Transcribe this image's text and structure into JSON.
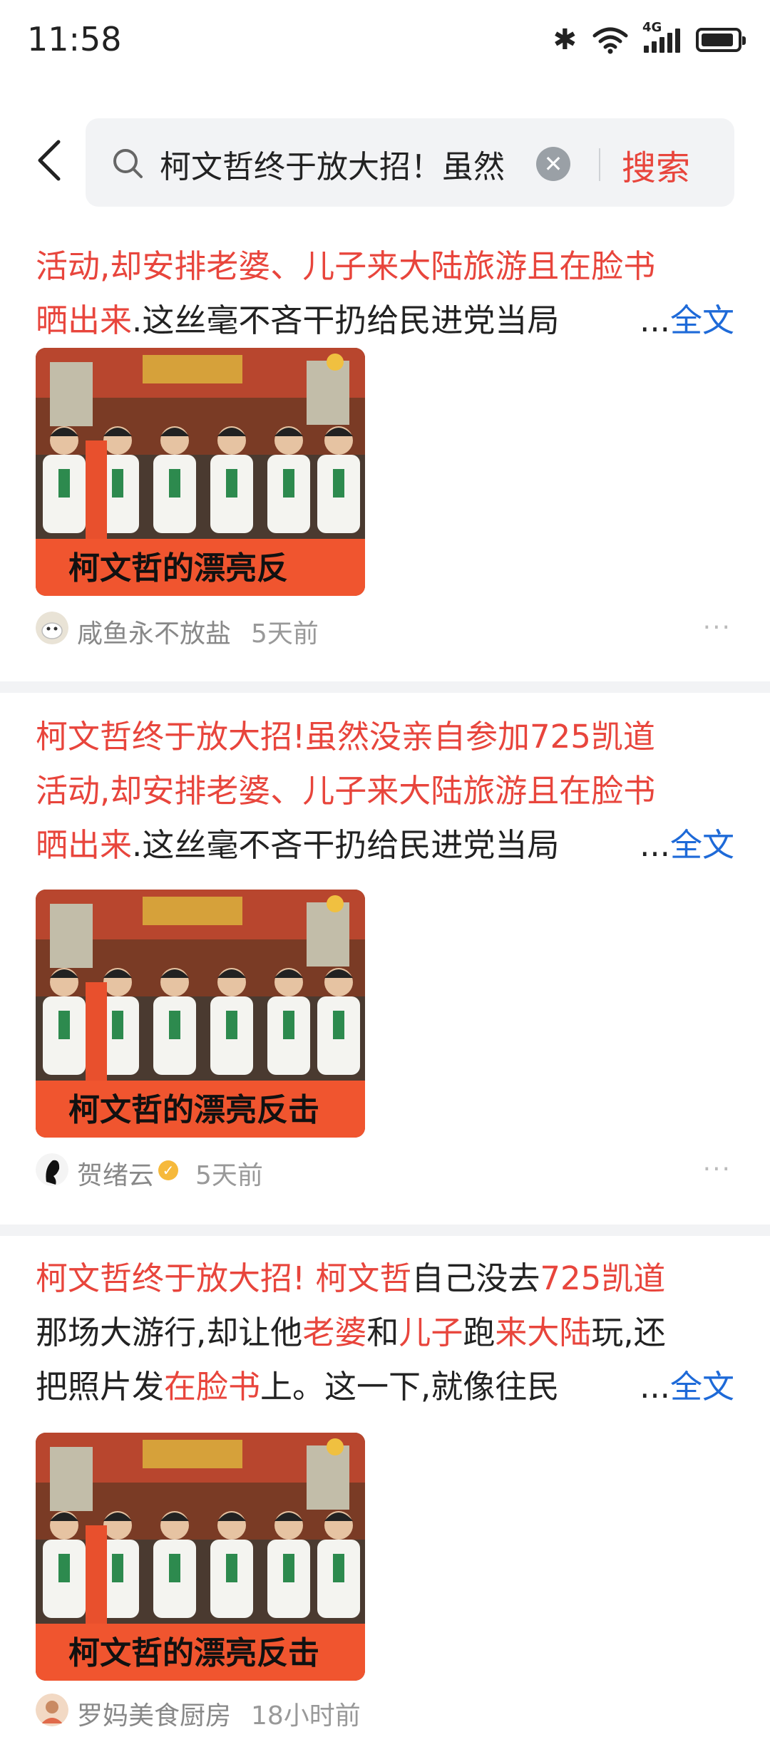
{
  "status_bar": {
    "time": "11:58",
    "network": "4G"
  },
  "search": {
    "query": "柯文哲终于放大招！虽然",
    "button": "搜索"
  },
  "common": {
    "full_text": "全文",
    "ellipsis": "..."
  },
  "cards": [
    {
      "lines": [
        [
          {
            "t": "活动,却安排老婆、儿子来大陆旅游且在脸书",
            "h": true
          }
        ],
        [
          {
            "t": "晒出来",
            "h": true
          },
          {
            "t": ".这丝毫不吝干扔给民进党当局",
            "h": false
          }
        ]
      ],
      "author": "咸鱼永不放盐",
      "time": "5天前",
      "thumb_caption": "柯文哲的漂亮反"
    },
    {
      "lines": [
        [
          {
            "t": "柯文哲终于放大招!虽然没亲自参加725凯道",
            "h": true
          }
        ],
        [
          {
            "t": "活动,却安排老婆、儿子来大陆旅游且在脸书",
            "h": true
          }
        ],
        [
          {
            "t": "晒出来",
            "h": true
          },
          {
            "t": ".这丝毫不吝干扔给民进党当局",
            "h": false
          }
        ]
      ],
      "author": "贺绪云",
      "time": "5天前",
      "thumb_caption": "柯文哲的漂亮反击"
    },
    {
      "lines": [
        [
          {
            "t": "柯文哲终于放大招! 柯文哲",
            "h": true
          },
          {
            "t": "自己没去",
            "h": false
          },
          {
            "t": "725凯道",
            "h": true
          }
        ],
        [
          {
            "t": "那场大游行,却让他",
            "h": false
          },
          {
            "t": "老婆",
            "h": true
          },
          {
            "t": "和",
            "h": false
          },
          {
            "t": "儿子",
            "h": true
          },
          {
            "t": "跑",
            "h": false
          },
          {
            "t": "来大陆",
            "h": true
          },
          {
            "t": "玩,还",
            "h": false
          }
        ],
        [
          {
            "t": "把照片发",
            "h": false
          },
          {
            "t": "在脸书",
            "h": true
          },
          {
            "t": "上。这一下,就像往民",
            "h": false
          }
        ]
      ],
      "author": "罗妈美食厨房",
      "time": "18小时前",
      "thumb_caption": "柯文哲的漂亮反击"
    }
  ],
  "colors": {
    "accent_red": "#e8453c",
    "link_blue": "#1e6ad8",
    "thumb_banner": "#f0552f"
  }
}
